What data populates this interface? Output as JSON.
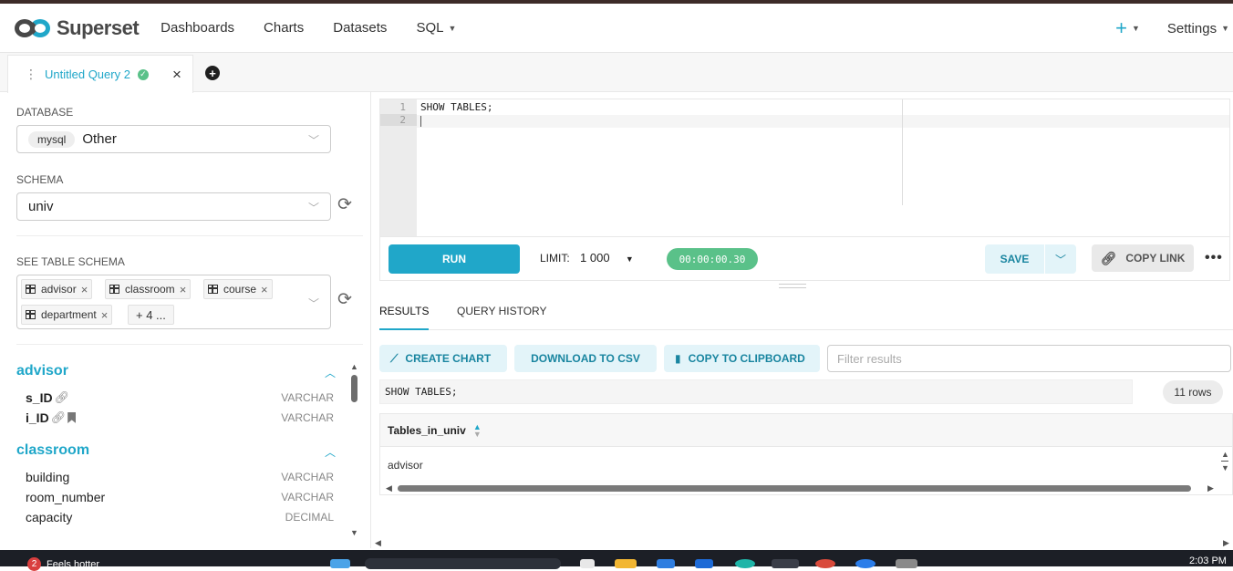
{
  "nav": {
    "brand": "Superset",
    "items": [
      "Dashboards",
      "Charts",
      "Datasets",
      "SQL"
    ],
    "plus": "+",
    "settings": "Settings"
  },
  "tab": {
    "title": "Untitled Query 2",
    "close": "×",
    "add": "+"
  },
  "left": {
    "database_label": "DATABASE",
    "database_tag": "mysql",
    "database_value": "Other",
    "schema_label": "SCHEMA",
    "schema_value": "univ",
    "table_schema_label": "SEE TABLE SCHEMA",
    "chips": [
      "advisor",
      "classroom",
      "course",
      "department"
    ],
    "chips_more": "+ 4 ...",
    "tables": [
      {
        "name": "advisor",
        "columns": [
          {
            "name": "s_ID",
            "type": "VARCHAR"
          },
          {
            "name": "i_ID",
            "type": "VARCHAR"
          }
        ]
      },
      {
        "name": "classroom",
        "columns": [
          {
            "name": "building",
            "type": "VARCHAR"
          },
          {
            "name": "room_number",
            "type": "VARCHAR"
          },
          {
            "name": "capacity",
            "type": "DECIMAL"
          }
        ]
      }
    ]
  },
  "editor": {
    "lines": [
      "1",
      "2"
    ],
    "code": "SHOW TABLES;"
  },
  "toolbar": {
    "run": "RUN",
    "limit_label": "LIMIT:",
    "limit_value": "1 000",
    "timer": "00:00:00.30",
    "save": "SAVE",
    "copy_link": "COPY LINK"
  },
  "results": {
    "tabs": [
      "RESULTS",
      "QUERY HISTORY"
    ],
    "create_chart": "CREATE CHART",
    "download_csv": "DOWNLOAD TO CSV",
    "copy_clipboard": "COPY TO CLIPBOARD",
    "filter_placeholder": "Filter results",
    "sql": "SHOW TABLES;",
    "row_count": "11 rows",
    "column_header": "Tables_in_univ",
    "rows": [
      "advisor"
    ]
  },
  "taskbar": {
    "weather_badge": "2",
    "weather_text": "Feels hotter",
    "clock": "2:03 PM"
  },
  "colors": {
    "primary": "#20a7c9",
    "success": "#5ac189",
    "light_primary": "#e3f4f9"
  }
}
